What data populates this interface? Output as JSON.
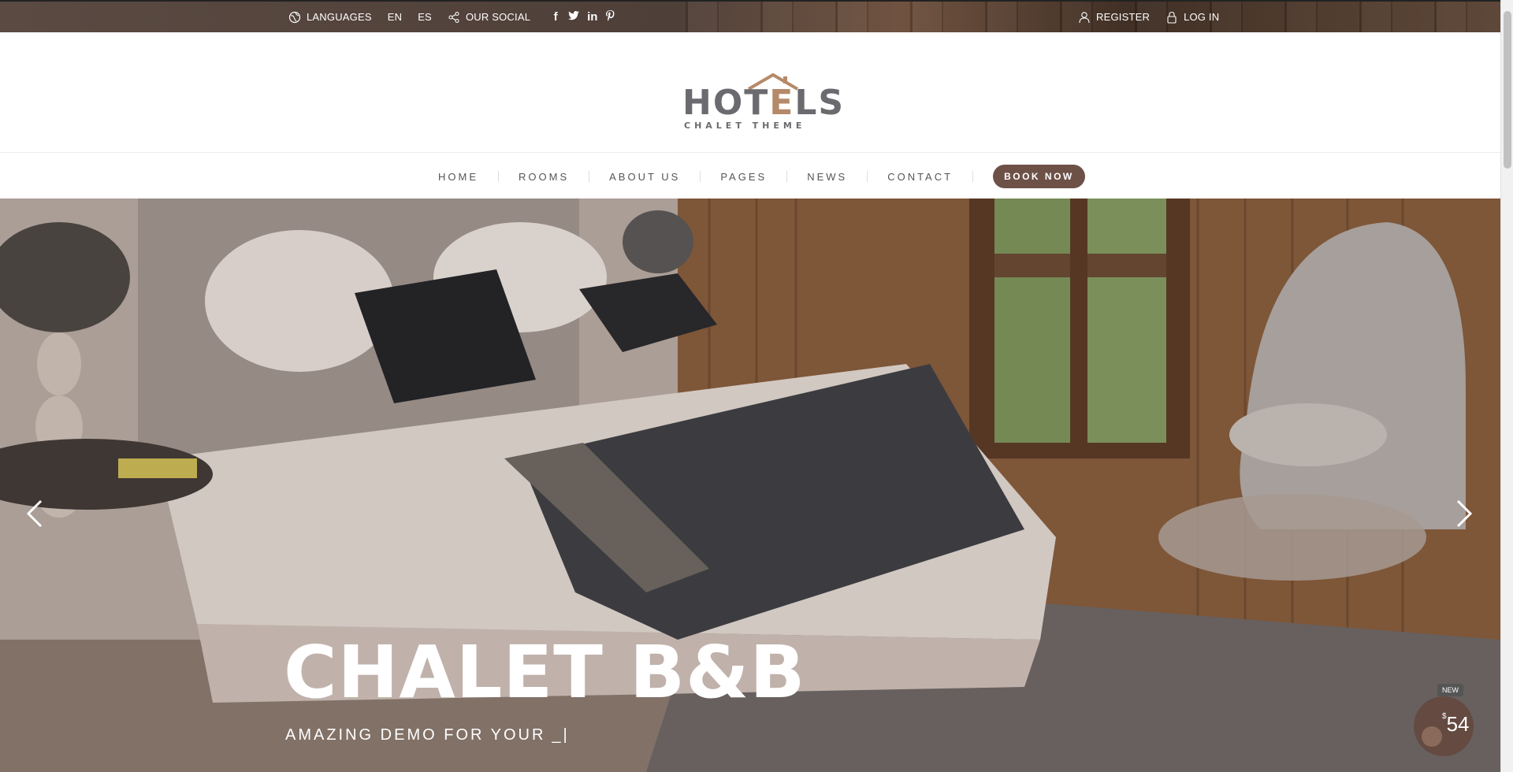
{
  "topbar": {
    "languages_label": "LANGUAGES",
    "lang_en": "EN",
    "lang_es": "ES",
    "social_label": "OUR SOCIAL",
    "social_icons": [
      "facebook-icon",
      "twitter-icon",
      "linkedin-icon",
      "pinterest-icon"
    ],
    "register_label": "REGISTER",
    "login_label": "LOG IN"
  },
  "logo": {
    "title_start": "HOT",
    "title_accent": "E",
    "title_end": "LS",
    "subtitle": "CHALET THEME"
  },
  "nav": {
    "items": [
      "HOME",
      "ROOMS",
      "ABOUT US",
      "PAGES",
      "NEWS",
      "CONTACT"
    ],
    "book_label": "BOOK NOW"
  },
  "hero": {
    "title": "CHALET B&B",
    "subtitle": "AMAZING DEMO FOR YOUR",
    "cursor": "_|"
  },
  "badge": {
    "new_label": "NEW",
    "currency": "$",
    "price": "54"
  },
  "colors": {
    "accent": "#6d5147",
    "logo_gray": "#6b6b6f",
    "logo_accent": "#b58a6a"
  }
}
